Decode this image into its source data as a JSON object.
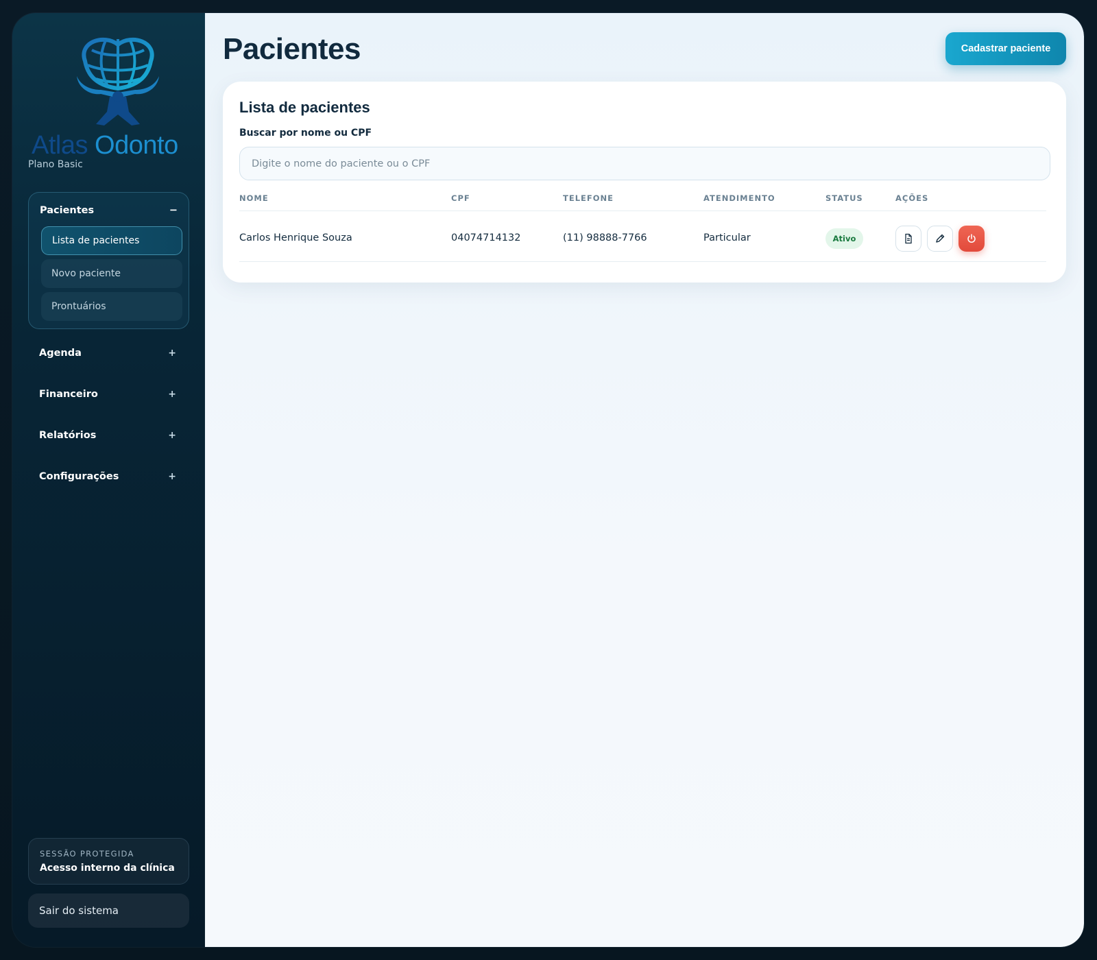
{
  "brand": {
    "name_part1": "Atlas",
    "name_part2": "Odonto",
    "plan": "Plano Basic"
  },
  "sidebar": {
    "open_group": {
      "label": "Pacientes",
      "toggle": "−",
      "items": [
        {
          "label": "Lista de pacientes",
          "active": true
        },
        {
          "label": "Novo paciente",
          "active": false
        },
        {
          "label": "Prontuários",
          "active": false
        }
      ]
    },
    "groups": [
      {
        "label": "Agenda",
        "toggle": "+"
      },
      {
        "label": "Financeiro",
        "toggle": "+"
      },
      {
        "label": "Relatórios",
        "toggle": "+"
      },
      {
        "label": "Configurações",
        "toggle": "+"
      }
    ],
    "session": {
      "caption": "SESSÃO PROTEGIDA",
      "value": "Acesso interno da clínica"
    },
    "logout_label": "Sair do sistema"
  },
  "header": {
    "title": "Pacientes",
    "primary_button": "Cadastrar paciente"
  },
  "card": {
    "title": "Lista de pacientes",
    "search": {
      "label": "Buscar por nome ou CPF",
      "placeholder": "Digite o nome do paciente ou o CPF",
      "value": ""
    },
    "columns": [
      "NOME",
      "CPF",
      "TELEFONE",
      "ATENDIMENTO",
      "STATUS",
      "AÇÕES"
    ],
    "rows": [
      {
        "nome": "Carlos Henrique Souza",
        "cpf": "04074714132",
        "telefone": "(11) 98888-7766",
        "atendimento": "Particular",
        "status": "Ativo",
        "actions": [
          "document-icon",
          "pencil-icon",
          "power-icon"
        ]
      }
    ]
  },
  "colors": {
    "accent": "#1aa7cf",
    "danger": "#e24a3b",
    "status_active_bg": "#e3f6ea",
    "status_active_text": "#1a7a3f",
    "title": "#112a3e"
  }
}
